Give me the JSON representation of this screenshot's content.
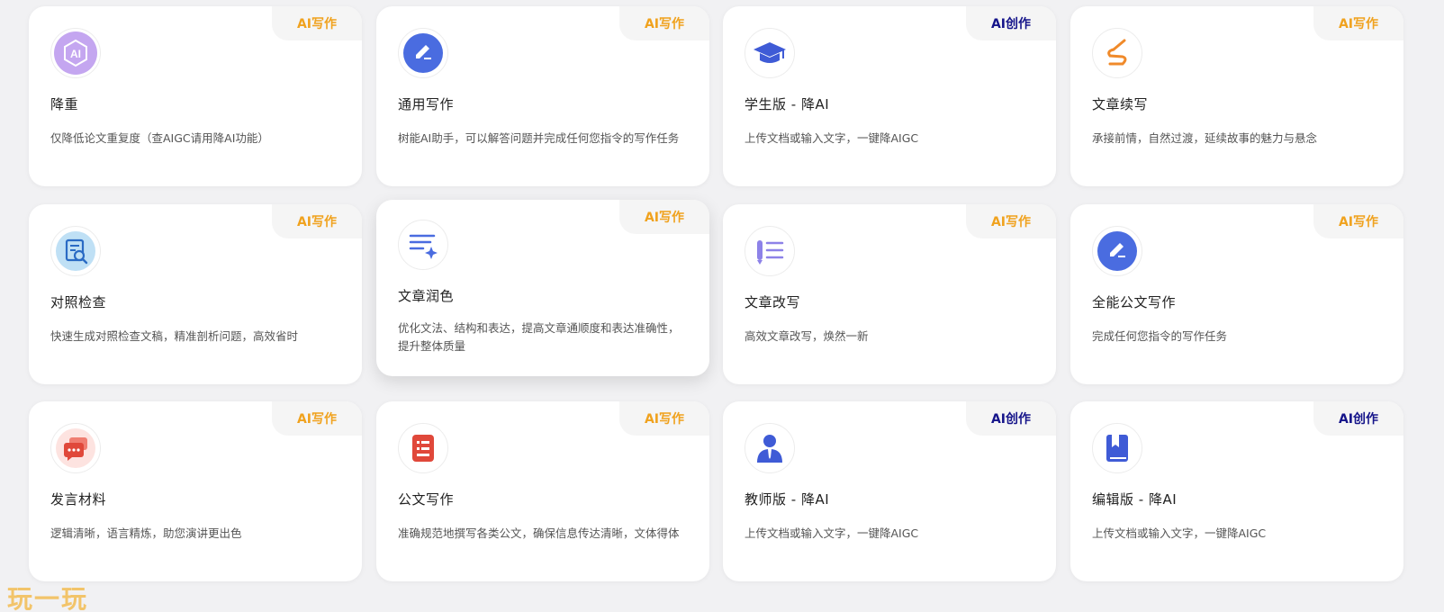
{
  "tags": {
    "write": "AI写作",
    "create": "AI创作"
  },
  "cards": [
    {
      "title": "降重",
      "desc": "仅降低论文重复度（查AIGC请用降AI功能）",
      "tag": "AI写作",
      "icon": "ai-badge-icon"
    },
    {
      "title": "通用写作",
      "desc": "树能AI助手，可以解答问题并完成任何您指令的写作任务",
      "tag": "AI写作",
      "icon": "pencil-circle-icon"
    },
    {
      "title": "学生版 - 降AI",
      "desc": "上传文档或输入文字，一键降AIGC",
      "tag": "AI创作",
      "icon": "graduation-cap-icon"
    },
    {
      "title": "文章续写",
      "desc": "承接前情，自然过渡，延续故事的魅力与悬念",
      "tag": "AI写作",
      "icon": "squiggle-pen-icon"
    },
    {
      "title": "对照检查",
      "desc": "快速生成对照检查文稿，精准剖析问题，高效省时",
      "tag": "AI写作",
      "icon": "document-search-icon"
    },
    {
      "title": "文章润色",
      "desc": "优化文法、结构和表达，提高文章通顺度和表达准确性，提升整体质量",
      "tag": "AI写作",
      "icon": "sparkle-lines-icon"
    },
    {
      "title": "文章改写",
      "desc": "高效文章改写，焕然一新",
      "tag": "AI写作",
      "icon": "pen-list-icon"
    },
    {
      "title": "全能公文写作",
      "desc": "完成任何您指令的写作任务",
      "tag": "AI写作",
      "icon": "pencil-circle-icon"
    },
    {
      "title": "发言材料",
      "desc": "逻辑清晰，语言精炼，助您演讲更出色",
      "tag": "AI写作",
      "icon": "chat-bubbles-icon"
    },
    {
      "title": "公文写作",
      "desc": "准确规范地撰写各类公文，确保信息传达清晰，文体得体",
      "tag": "AI写作",
      "icon": "document-list-icon"
    },
    {
      "title": "教师版 - 降AI",
      "desc": "上传文档或输入文字，一键降AIGC",
      "tag": "AI创作",
      "icon": "teacher-person-icon"
    },
    {
      "title": "编辑版 - 降AI",
      "desc": "上传文档或输入文字，一键降AIGC",
      "tag": "AI创作",
      "icon": "bookmark-book-icon"
    }
  ],
  "watermark": "玩一玩",
  "colors": {
    "write_tag": "#f0a21e",
    "create_tag": "#15148a",
    "blue_icon": "#4a6ce0",
    "purple_icon": "#b57de8",
    "orange_icon": "#f08a2a",
    "red_icon": "#e0483a"
  }
}
